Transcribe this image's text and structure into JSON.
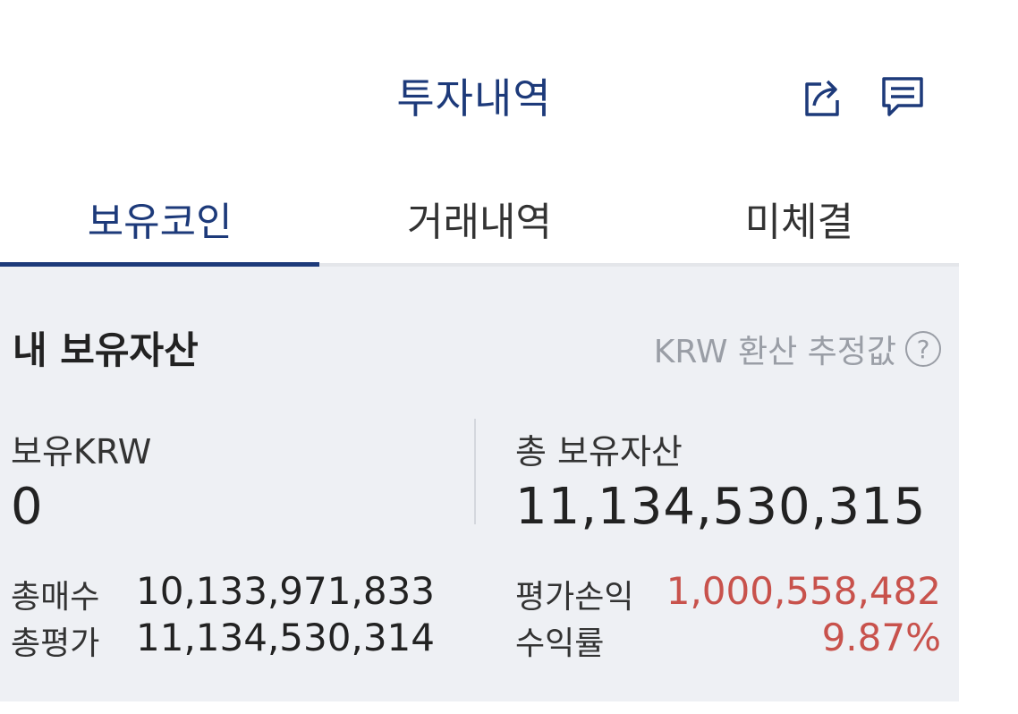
{
  "header": {
    "title": "투자내역",
    "share_icon": "share-icon",
    "message_icon": "message-icon"
  },
  "tabs": [
    {
      "label": "보유코인",
      "active": true
    },
    {
      "label": "거래내역",
      "active": false
    },
    {
      "label": "미체결",
      "active": false
    }
  ],
  "assets": {
    "title": "내 보유자산",
    "note": "KRW 환산 추정값",
    "note_icon": "help-icon",
    "krw_label": "보유KRW",
    "krw_value": "0",
    "total_label": "총 보유자산",
    "total_value": "11,134,530,315",
    "buy_label": "총매수",
    "buy_value": "10,133,971,833",
    "eval_label": "총평가",
    "eval_value": "11,134,530,314",
    "pnl_label": "평가손익",
    "pnl_value": "1,000,558,482",
    "rate_label": "수익률",
    "rate_value": "9.87%"
  },
  "colors": {
    "brand": "#1d3a7a",
    "profit": "#c8524c",
    "panel_bg": "#eef0f4"
  }
}
